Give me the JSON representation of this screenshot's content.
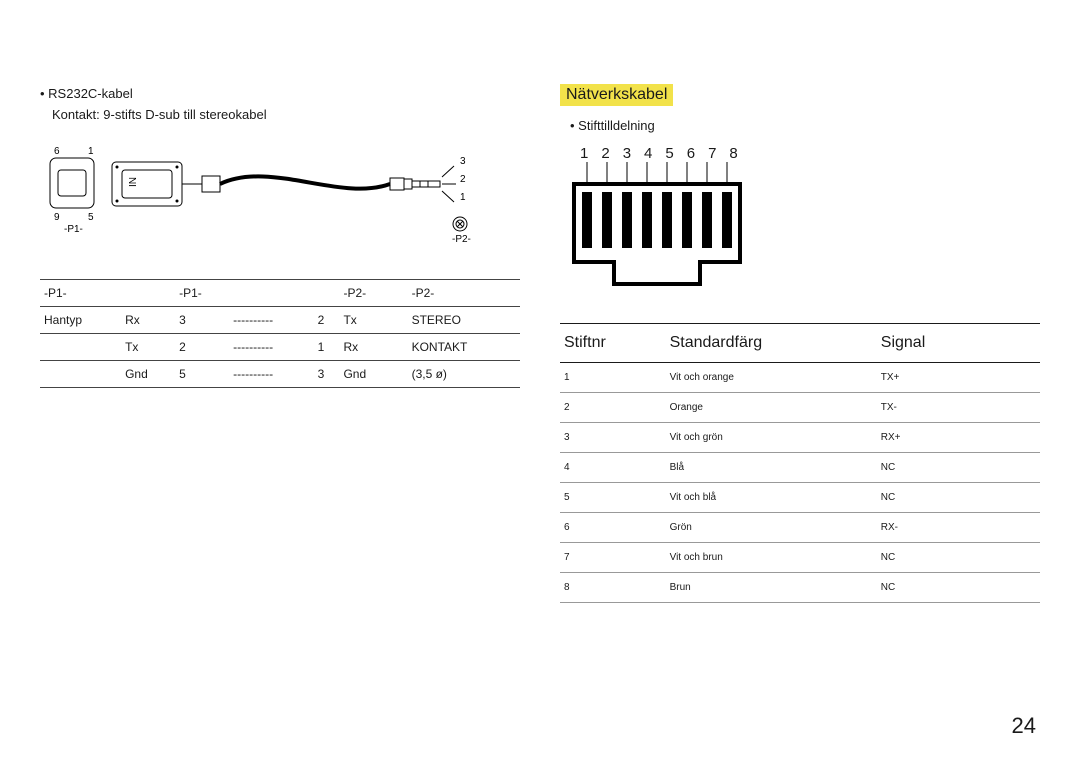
{
  "page_number": "24",
  "left": {
    "bullet": "RS232C-kabel",
    "subtitle": "Kontakt: 9-stifts D-sub till stereokabel",
    "fig": {
      "p1_top_left": "6",
      "p1_top_right": "1",
      "p1_bot_left": "9",
      "p1_bot_right": "5",
      "p1_label": "-P1-",
      "in_label": "IN",
      "jack_3": "3",
      "jack_2": "2",
      "jack_1": "1",
      "p2_label": "-P2-"
    },
    "table": {
      "h1": "-P1-",
      "h2": "-P1-",
      "h3": "-P2-",
      "h4": "-P2-",
      "row_label": "Hantyp",
      "dash": "----------",
      "rows": [
        {
          "a": "Rx",
          "b": "3",
          "c": "2",
          "d": "Tx",
          "e": "STEREO"
        },
        {
          "a": "Tx",
          "b": "2",
          "c": "1",
          "d": "Rx",
          "e": "KONTAKT"
        },
        {
          "a": "Gnd",
          "b": "5",
          "c": "3",
          "d": "Gnd",
          "e": "(3,5 ø)"
        }
      ]
    }
  },
  "right": {
    "heading": "Nätverkskabel",
    "bullet": "Stifttilldelning",
    "pin_numbers": [
      "1",
      "2",
      "3",
      "4",
      "5",
      "6",
      "7",
      "8"
    ],
    "table": {
      "h1": "Stiftnr",
      "h2": "Standardfärg",
      "h3": "Signal",
      "rows": [
        {
          "n": "1",
          "c": "Vit och orange",
          "s": "TX+"
        },
        {
          "n": "2",
          "c": "Orange",
          "s": "TX-"
        },
        {
          "n": "3",
          "c": "Vit och grön",
          "s": "RX+"
        },
        {
          "n": "4",
          "c": "Blå",
          "s": "NC"
        },
        {
          "n": "5",
          "c": "Vit och blå",
          "s": "NC"
        },
        {
          "n": "6",
          "c": "Grön",
          "s": "RX-"
        },
        {
          "n": "7",
          "c": "Vit och brun",
          "s": "NC"
        },
        {
          "n": "8",
          "c": "Brun",
          "s": "NC"
        }
      ]
    }
  }
}
